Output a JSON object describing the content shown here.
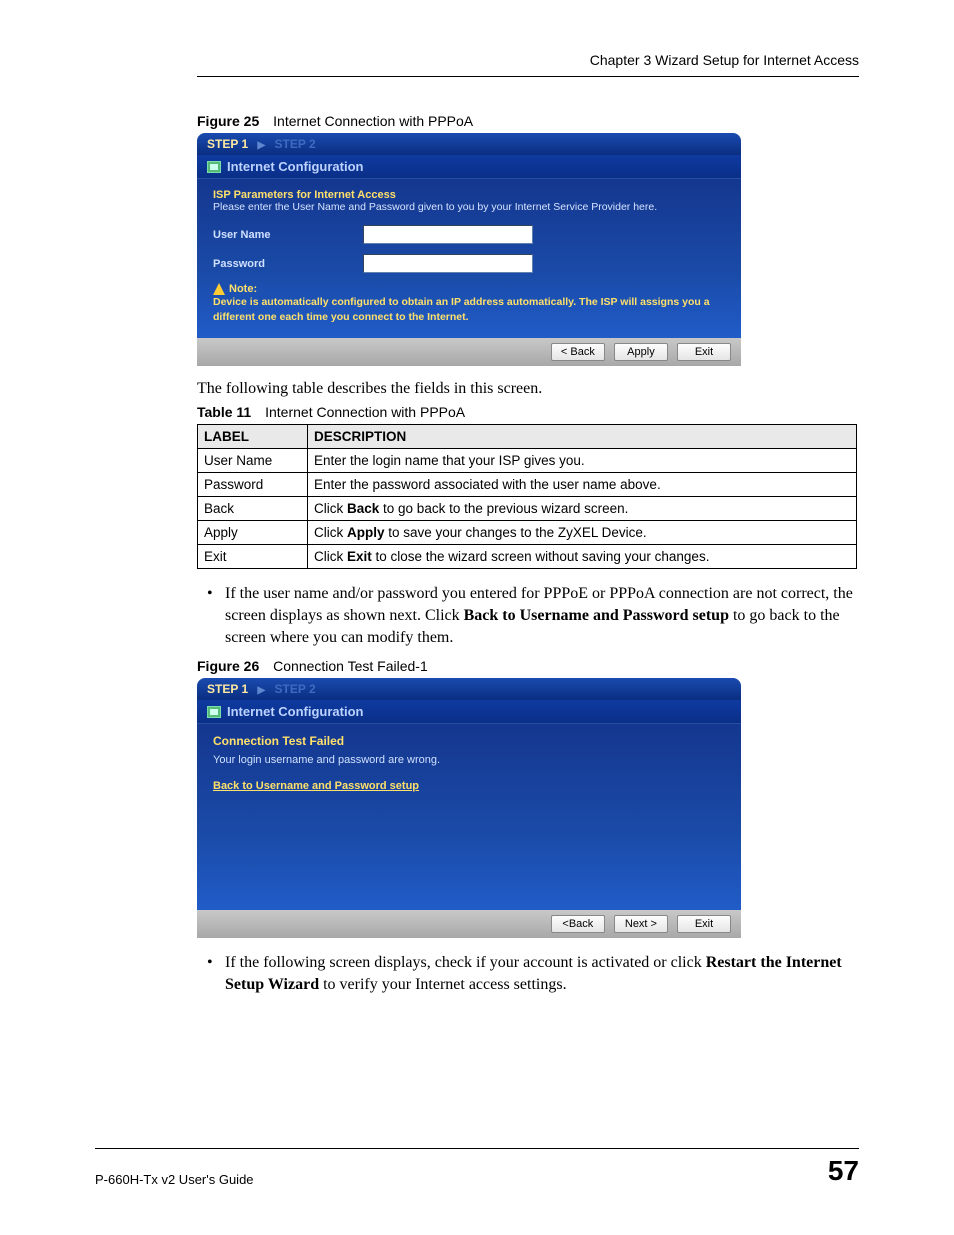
{
  "header": {
    "chapter": "Chapter 3 Wizard Setup for Internet Access"
  },
  "fig25": {
    "caption_num": "Figure 25",
    "caption_text": "Internet Connection with PPPoA",
    "steps": {
      "s1": "STEP 1",
      "s2": "STEP 2"
    },
    "title": "Internet Configuration",
    "sub": "ISP Parameters for Internet Access",
    "instr": "Please enter the User Name and Password given to you by your Internet Service Provider here.",
    "user_label": "User Name",
    "pass_label": "Password",
    "note_head": "Note:",
    "note_text": "Device is automatically configured to obtain an IP address automatically. The ISP will assigns you a different one each time you connect to the Internet.",
    "btn_back": "< Back",
    "btn_apply": "Apply",
    "btn_exit": "Exit"
  },
  "intro_text": "The following table describes the fields in this screen.",
  "table11": {
    "caption_num": "Table 11",
    "caption_text": "Internet Connection with PPPoA",
    "head_label": "LABEL",
    "head_desc": "DESCRIPTION",
    "rows": [
      {
        "label": "User Name",
        "desc_pre": "Enter the login name that your ISP gives you.",
        "bold": "",
        "desc_post": ""
      },
      {
        "label": "Password",
        "desc_pre": "Enter the password associated with the user name above.",
        "bold": "",
        "desc_post": ""
      },
      {
        "label": "Back",
        "desc_pre": "Click ",
        "bold": "Back",
        "desc_post": " to go back to the previous wizard screen."
      },
      {
        "label": "Apply",
        "desc_pre": "Click ",
        "bold": "Apply",
        "desc_post": " to save your changes to the ZyXEL Device."
      },
      {
        "label": "Exit",
        "desc_pre": "Click ",
        "bold": "Exit",
        "desc_post": " to close the wizard screen without saving your changes."
      }
    ]
  },
  "bullet1": {
    "pre": "If the user name and/or password you entered for PPPoE or PPPoA connection are not correct, the screen displays as shown next. Click ",
    "bold": "Back to Username and Password setup",
    "post": " to go back to the screen where you can modify them."
  },
  "fig26": {
    "caption_num": "Figure 26",
    "caption_text": "Connection Test Failed-1",
    "steps": {
      "s1": "STEP 1",
      "s2": "STEP 2"
    },
    "title": "Internet Configuration",
    "fail_head": "Connection Test Failed",
    "fail_msg": "Your login username and password are wrong.",
    "fail_link": "Back to Username and Password setup",
    "btn_back": "<Back",
    "btn_next": "Next >",
    "btn_exit": "Exit"
  },
  "bullet2": {
    "pre": "If the following screen displays, check if your account is activated or click ",
    "bold": "Restart the Internet Setup Wizard",
    "post": " to verify your Internet access settings."
  },
  "footer": {
    "guide": "P-660H-Tx v2 User's Guide",
    "page": "57"
  }
}
